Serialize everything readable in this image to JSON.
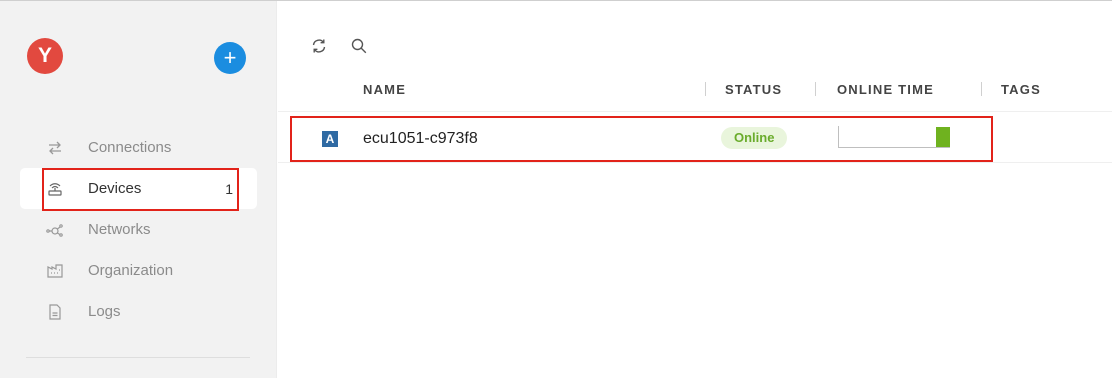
{
  "sidebar": {
    "avatar_letter": "Y",
    "add_button_label": "+",
    "items": [
      {
        "label": "Connections",
        "icon": "arrows-swap-icon",
        "count": ""
      },
      {
        "label": "Devices",
        "icon": "router-icon",
        "count": "1"
      },
      {
        "label": "Networks",
        "icon": "network-nodes-icon",
        "count": ""
      },
      {
        "label": "Organization",
        "icon": "building-icon",
        "count": ""
      },
      {
        "label": "Logs",
        "icon": "document-icon",
        "count": ""
      }
    ]
  },
  "toolbar": {
    "refresh_icon": "refresh-icon",
    "search_icon": "search-icon"
  },
  "table": {
    "columns": [
      "NAME",
      "STATUS",
      "ONLINE TIME",
      "TAGS"
    ],
    "rows": [
      {
        "icon_letter": "A",
        "name": "ecu1051-c973f8",
        "status": "Online",
        "online_fraction": 0.13
      }
    ]
  },
  "colors": {
    "avatar": "#e2493f",
    "add_button": "#1b8de0",
    "status_online_bg": "#e9f5dc",
    "status_online_text": "#6aac2c",
    "online_time_fill": "#6fb21f",
    "highlight": "#e2231a"
  }
}
